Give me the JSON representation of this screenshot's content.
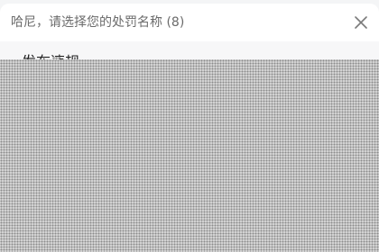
{
  "dialog": {
    "title": "哈尼，请选择您的处罚名称 (8)",
    "close_icon": "close-icon"
  },
  "options": [
    {
      "label": "发布违规"
    }
  ]
}
